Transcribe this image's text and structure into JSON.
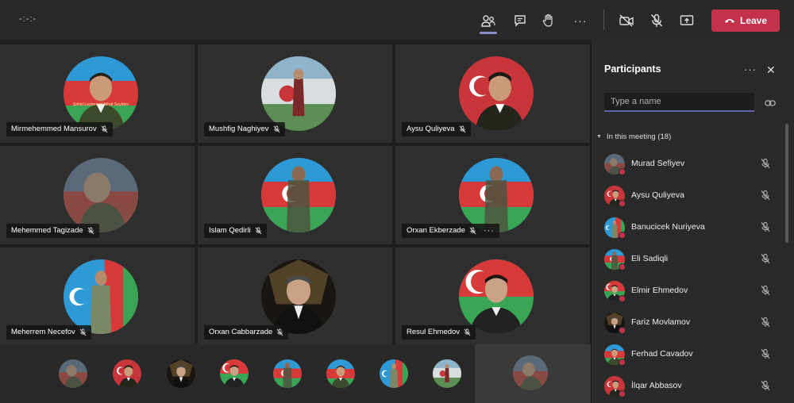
{
  "toolbar": {
    "timer": "-:-:-",
    "leave_label": "Leave",
    "colors": {
      "leave": "#c4314b",
      "accent": "#6264a7"
    }
  },
  "tiles": [
    {
      "name": "Mirmehemmed Mansurov",
      "photo_caption": "Şəhid Leytenant Nihat Seyidov"
    },
    {
      "name": "Mushfig Naghiyev"
    },
    {
      "name": "Aysu Quliyeva"
    },
    {
      "name": "Mehemmed Tagizade"
    },
    {
      "name": "Islam Qedirli"
    },
    {
      "name": "Orxan Ekberzade",
      "more": "···"
    },
    {
      "name": "Meherrem Necefov"
    },
    {
      "name": "Orxan Cabbarzade"
    },
    {
      "name": "Resul Ehmedov"
    }
  ],
  "panel": {
    "title": "Participants",
    "more": "···",
    "close": "✕",
    "search_placeholder": "Type a name",
    "section_label": "In this meeting (18)",
    "participants": [
      "Murad Sefiyev",
      "Aysu Quliyeva",
      "Banucicek Nuriyeva",
      "Eli Sadiqli",
      "Elmir Ehmedov",
      "Fariz Movlamov",
      "Ferhad Cavadov",
      "İlqar Abbasov"
    ]
  }
}
